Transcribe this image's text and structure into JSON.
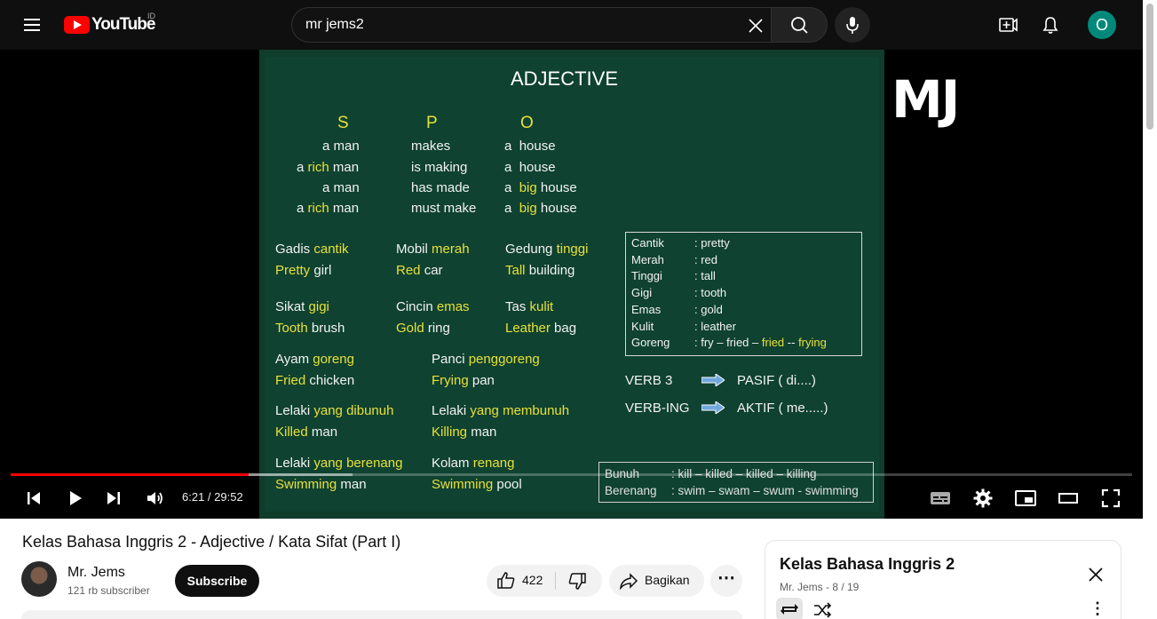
{
  "header": {
    "logo_text": "YouTube",
    "country_code": "ID",
    "search_value": "mr jems2",
    "avatar_letter": "O"
  },
  "video": {
    "watermark": "MJ",
    "board": {
      "title": "ADJECTIVE",
      "heads": [
        "S",
        "P",
        "O"
      ],
      "spo_rows": [
        {
          "s_pre": "a",
          "s_adj": "",
          "s_noun": "man",
          "p": "makes",
          "o_pre": "a",
          "o_adj": "",
          "o_noun": "house"
        },
        {
          "s_pre": "a",
          "s_adj": "rich",
          "s_noun": "man",
          "p": "is making",
          "o_pre": "a",
          "o_adj": "",
          "o_noun": "house"
        },
        {
          "s_pre": "a",
          "s_adj": "",
          "s_noun": "man",
          "p": "has made",
          "o_pre": "a",
          "o_adj": "big",
          "o_noun": "house"
        },
        {
          "s_pre": "a",
          "s_adj": "rich",
          "s_noun": "man",
          "p": "must make",
          "o_pre": "a",
          "o_adj": "big",
          "o_noun": "house"
        }
      ],
      "pairs": [
        {
          "w1": "Gadis",
          "a1": "cantik",
          "a2": "Pretty",
          "w2": "girl"
        },
        {
          "w1": "Mobil",
          "a1": "merah",
          "a2": "Red",
          "w2": "car"
        },
        {
          "w1": "Gedung",
          "a1": "tinggi",
          "a2": "Tall",
          "w2": "building"
        },
        {
          "w1": "Sikat",
          "a1": "gigi",
          "a2": "Tooth",
          "w2": "brush"
        },
        {
          "w1": "Cincin",
          "a1": "emas",
          "a2": "Gold",
          "w2": "ring"
        },
        {
          "w1": "Tas",
          "a1": "kulit",
          "a2": "Leather",
          "w2": "bag"
        },
        {
          "w1": "Ayam",
          "a1": "goreng",
          "a2": "Fried",
          "w2": "chicken"
        },
        {
          "w1": "Panci",
          "a1": "penggoreng",
          "a2": "Frying",
          "w2": "pan"
        },
        {
          "w1": "Lelaki",
          "a1": "yang dibunuh",
          "a2": "Killed",
          "w2": "man"
        },
        {
          "w1": "Lelaki",
          "a1": "yang membunuh",
          "a2": "Killing",
          "w2": "man"
        },
        {
          "w1": "Lelaki",
          "a1": "yang berenang",
          "a2": "Swimming",
          "w2": "man"
        },
        {
          "w1": "Kolam",
          "a1": "renang",
          "a2": "Swimming",
          "w2": "pool"
        }
      ],
      "vocab": [
        {
          "k": "Cantik",
          "v": ": pretty"
        },
        {
          "k": "Merah",
          "v": ": red"
        },
        {
          "k": "Tinggi",
          "v": ": tall"
        },
        {
          "k": "Gigi",
          "v": ": tooth"
        },
        {
          "k": "Emas",
          "v": ": gold"
        },
        {
          "k": "Kulit",
          "v": ": leather"
        },
        {
          "k": "Goreng",
          "v": ": fry – fried  –",
          "y1": "fried",
          "sep": " -- ",
          "y2": "frying"
        }
      ],
      "verb3": "VERB 3",
      "verb3_result": "PASIF ( di....)",
      "verbing": "VERB-ING",
      "verbing_result": "AKTIF ( me.....)",
      "bunuh": {
        "k": "Bunuh",
        "v": ": kill – killed – killed – killing"
      },
      "berenang": {
        "k": "Berenang",
        "v": ": swim – swam – swum - swimming"
      }
    },
    "time_display": "6:21 / 29:52",
    "progress_fraction": 0.212
  },
  "meta": {
    "title": "Kelas Bahasa Inggris 2 - Adjective / Kata Sifat (Part I)",
    "channel_name": "Mr. Jems",
    "subscribers": "121 rb subscriber",
    "subscribe_label": "Subscribe",
    "like_count": "422",
    "share_label": "Bagikan"
  },
  "playlist": {
    "title": "Kelas Bahasa Inggris 2",
    "subtitle": "Mr. Jems - 8 / 19"
  }
}
